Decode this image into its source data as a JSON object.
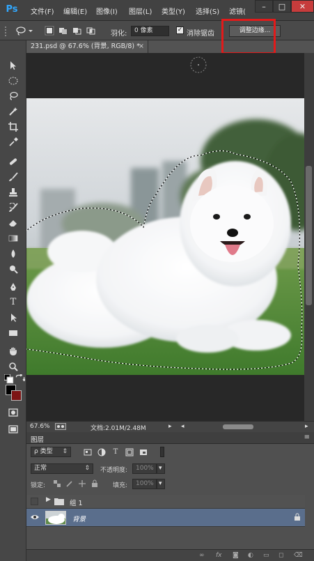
{
  "app": {
    "logo": "Ps"
  },
  "menu": [
    "文件(F)",
    "编辑(E)",
    "图像(I)",
    "图层(L)",
    "类型(Y)",
    "选择(S)",
    "滤镜("
  ],
  "window_controls": {
    "minimize": "–",
    "maximize": "□",
    "close": "✕"
  },
  "options": {
    "feather_label": "羽化:",
    "feather_value": "0 像素",
    "antialias_label": "消除锯齿",
    "antialias_checked": true,
    "refine_edge": "调整边缘..."
  },
  "document": {
    "tab_title": "231.psd @ 67.6% (背景, RGB/8) *",
    "tab_close": "×"
  },
  "status": {
    "zoom": "67.6%",
    "doc_info": "文档:2.01M/2.48M"
  },
  "layers_panel": {
    "tab": "图层",
    "filter_kind": "ρ 类型",
    "blend_mode": "正常",
    "opacity_label": "不透明度:",
    "opacity_value": "100%",
    "lock_label": "锁定:",
    "fill_label": "填充:",
    "fill_value": "100%",
    "layers": [
      {
        "name": "组 1",
        "type": "group",
        "visible": false
      },
      {
        "name": "背景",
        "type": "image",
        "visible": true,
        "selected": true,
        "locked": true
      }
    ]
  },
  "colors": {
    "accent_highlight": "#e21a1a",
    "selected_layer": "#5a6e8c",
    "foreground": "#000000",
    "background": "#7d1414"
  },
  "icons": [
    "lasso-icon",
    "move-icon",
    "marquee-icon",
    "magic-wand-icon",
    "crop-icon",
    "eyedropper-icon",
    "healing-brush-icon",
    "brush-icon",
    "clone-stamp-icon",
    "history-brush-icon",
    "eraser-icon",
    "gradient-icon",
    "blur-icon",
    "dodge-icon",
    "pen-icon",
    "type-icon",
    "path-selection-icon",
    "rectangle-icon",
    "hand-icon",
    "zoom-icon",
    "eye-icon",
    "folder-icon",
    "lock-icon"
  ]
}
